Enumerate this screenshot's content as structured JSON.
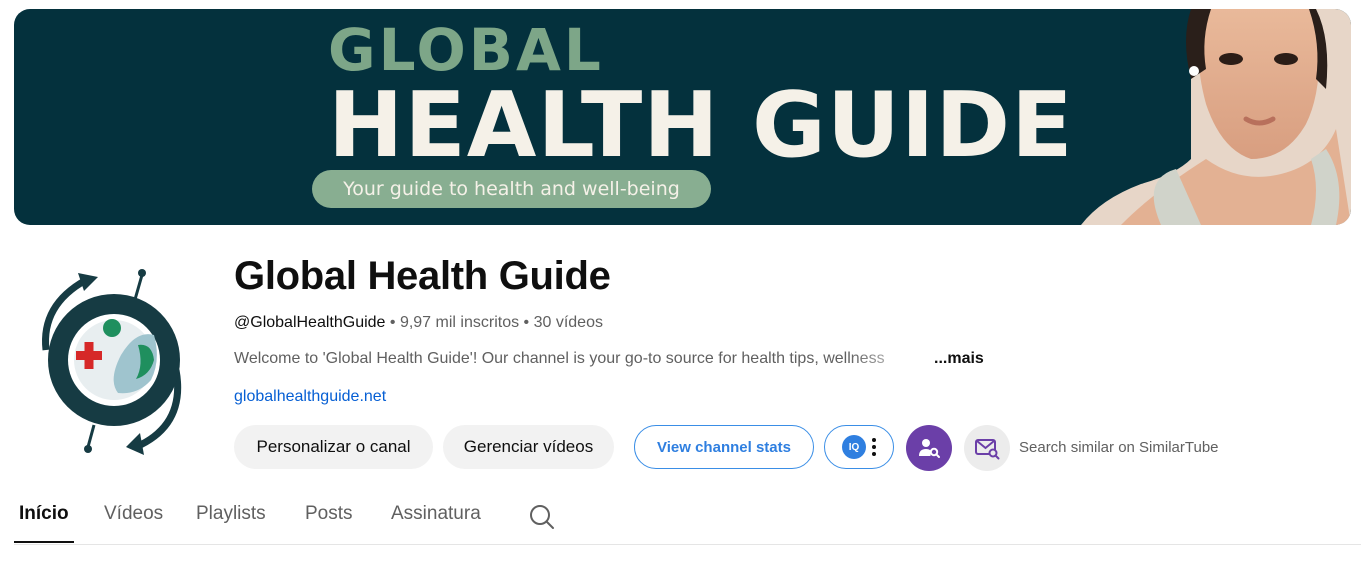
{
  "banner": {
    "line1": "GLOBAL",
    "line2": "HEALTH GUIDE",
    "tagline": "Your guide to health and well-being"
  },
  "channel": {
    "name": "Global Health Guide",
    "handle": "@GlobalHealthGuide",
    "subscribers": "9,97 mil inscritos",
    "videos": "30 vídeos",
    "separator": " • ",
    "description": "Welcome to 'Global Health Guide'! Our channel is your go-to source for health tips, wellness",
    "more_label": "...mais",
    "website": "globalhealthguide.net"
  },
  "actions": {
    "customize_label": "Personalizar o canal",
    "manage_label": "Gerenciar vídeos",
    "stats_label": "View channel stats",
    "extension_logo": "IQ",
    "similar_label": "Search similar on SimilarTube"
  },
  "tabs": [
    {
      "label": "Início",
      "active": true
    },
    {
      "label": "Vídeos",
      "active": false
    },
    {
      "label": "Playlists",
      "active": false
    },
    {
      "label": "Posts",
      "active": false
    },
    {
      "label": "Assinatura",
      "active": false
    }
  ],
  "colors": {
    "banner_bg": "#04313d",
    "accent_green": "#7da688",
    "link_blue": "#065fd4",
    "stats_blue": "#2f7fe0",
    "purple": "#6b3fa8"
  },
  "icons": [
    "search-icon",
    "user-search-icon",
    "mail-search-icon",
    "kebab-menu-icon"
  ]
}
